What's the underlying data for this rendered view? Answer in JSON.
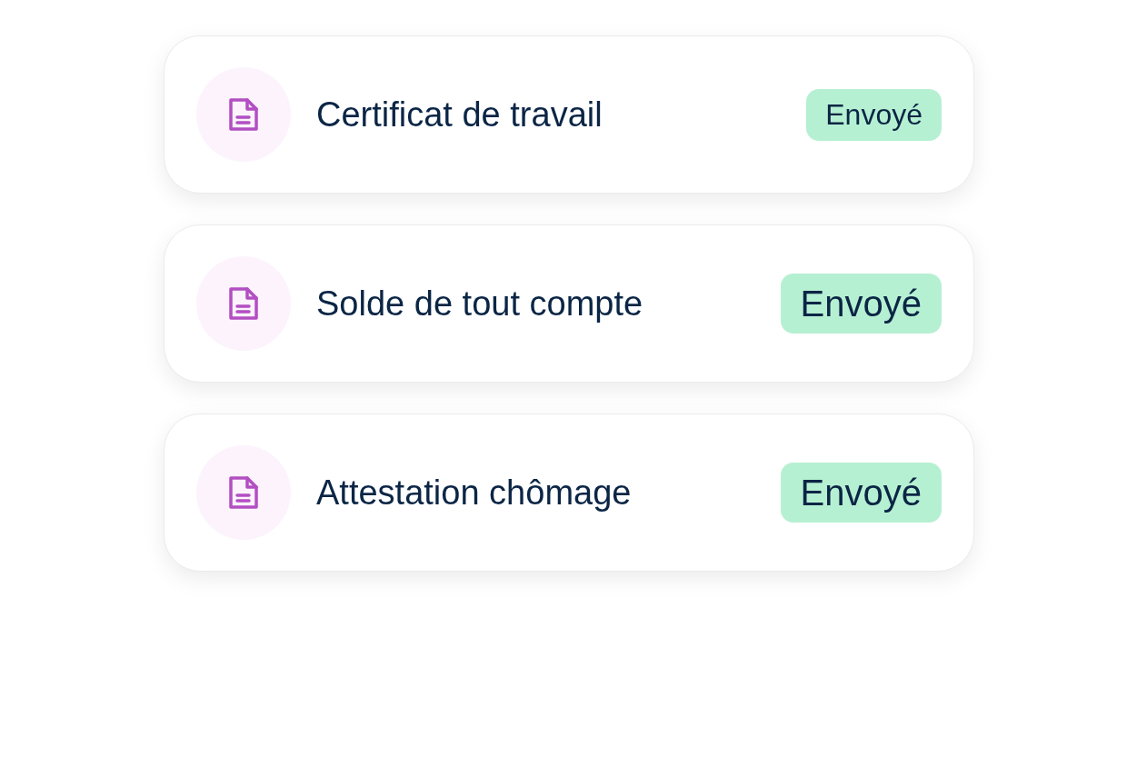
{
  "documents": [
    {
      "title": "Certificat de travail",
      "status": {
        "label": "Envoyé",
        "kind": "compact"
      }
    },
    {
      "title": "Solde de tout compte",
      "status": {
        "label": "Envoyé",
        "kind": "large"
      }
    },
    {
      "title": "Attestation chômage",
      "status": {
        "label": "Envoyé",
        "kind": "large"
      }
    }
  ]
}
